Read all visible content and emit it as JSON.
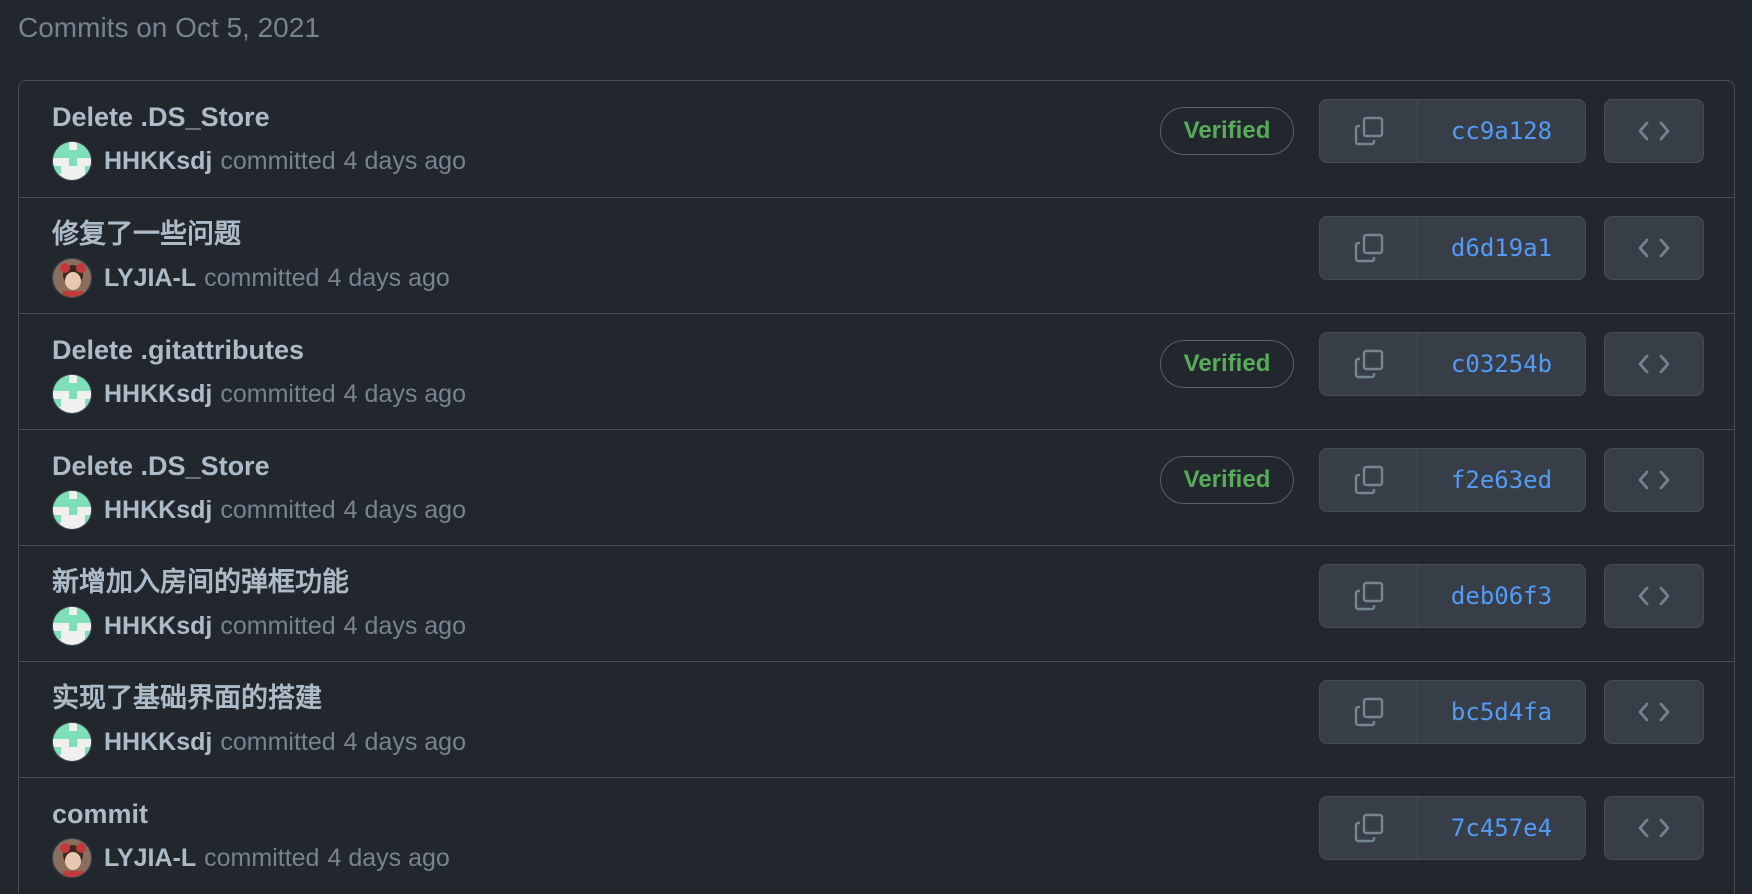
{
  "group_title": "Commits on Oct 5, 2021",
  "committed_text": "committed",
  "commits": [
    {
      "message": "Delete .DS_Store",
      "author": "HHKKsdj",
      "time": "4 days ago",
      "verified": "Verified",
      "sha": "cc9a128",
      "avatar": "identicon"
    },
    {
      "message": "修复了一些问题",
      "author": "LYJIA-L",
      "time": "4 days ago",
      "verified": "",
      "sha": "d6d19a1",
      "avatar": "photo"
    },
    {
      "message": "Delete .gitattributes",
      "author": "HHKKsdj",
      "time": "4 days ago",
      "verified": "Verified",
      "sha": "c03254b",
      "avatar": "identicon"
    },
    {
      "message": "Delete .DS_Store",
      "author": "HHKKsdj",
      "time": "4 days ago",
      "verified": "Verified",
      "sha": "f2e63ed",
      "avatar": "identicon"
    },
    {
      "message": "新增加入房间的弹框功能",
      "author": "HHKKsdj",
      "time": "4 days ago",
      "verified": "",
      "sha": "deb06f3",
      "avatar": "identicon"
    },
    {
      "message": "实现了基础界面的搭建",
      "author": "HHKKsdj",
      "time": "4 days ago",
      "verified": "",
      "sha": "bc5d4fa",
      "avatar": "identicon"
    },
    {
      "message": "commit",
      "author": "LYJIA-L",
      "time": "4 days ago",
      "verified": "",
      "sha": "7c457e4",
      "avatar": "photo"
    }
  ],
  "icons": {
    "copy": "copy-icon",
    "browse": "code-icon"
  },
  "colors": {
    "background": "#22272e",
    "verified": "#57ab5a",
    "sha_link": "#539bf5",
    "identicon": "#7ee0b8"
  }
}
